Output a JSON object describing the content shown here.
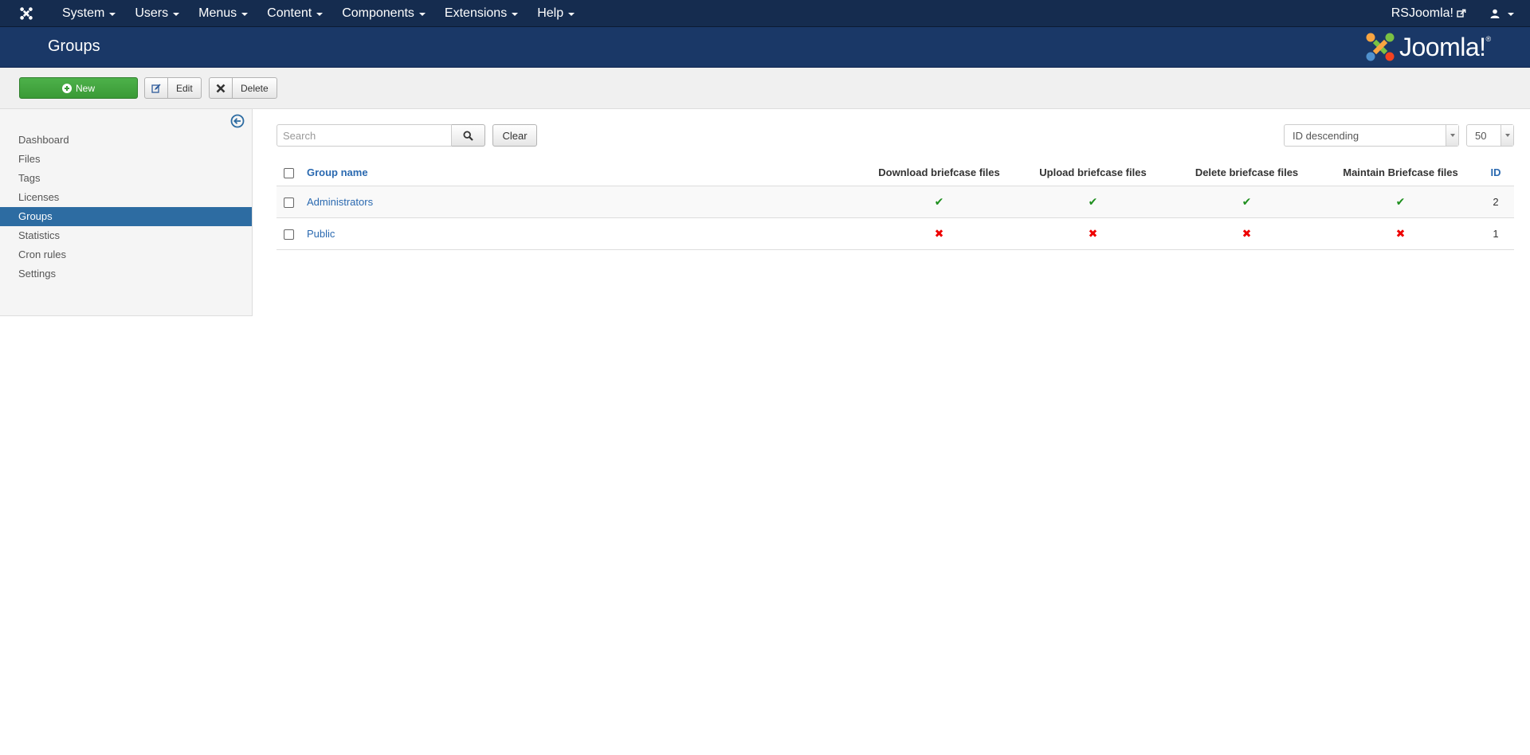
{
  "navbar": {
    "menu": [
      {
        "label": "System"
      },
      {
        "label": "Users"
      },
      {
        "label": "Menus"
      },
      {
        "label": "Content"
      },
      {
        "label": "Components"
      },
      {
        "label": "Extensions"
      },
      {
        "label": "Help"
      }
    ],
    "site_label": "RSJoomla!"
  },
  "header": {
    "title": "Groups",
    "brand": "Joomla!",
    "brand_mark": "®"
  },
  "toolbar": {
    "new_label": "New",
    "edit_label": "Edit",
    "delete_label": "Delete"
  },
  "sidebar": {
    "items": [
      {
        "label": "Dashboard"
      },
      {
        "label": "Files"
      },
      {
        "label": "Tags"
      },
      {
        "label": "Licenses"
      },
      {
        "label": "Groups",
        "active": true
      },
      {
        "label": "Statistics"
      },
      {
        "label": "Cron rules"
      },
      {
        "label": "Settings"
      }
    ]
  },
  "filters": {
    "search_placeholder": "Search",
    "search_value": "",
    "clear_label": "Clear",
    "sort_selected": "ID descending",
    "limit_selected": "50"
  },
  "table": {
    "columns": {
      "name": "Group name",
      "download": "Download briefcase files",
      "upload": "Upload briefcase files",
      "delete": "Delete briefcase files",
      "maintain": "Maintain Briefcase files",
      "id": "ID"
    },
    "rows": [
      {
        "name": "Administrators",
        "download": true,
        "upload": true,
        "delete": true,
        "maintain": true,
        "id": "2"
      },
      {
        "name": "Public",
        "download": false,
        "upload": false,
        "delete": false,
        "maintain": false,
        "id": "1"
      }
    ]
  },
  "colors": {
    "navbar_bg": "#152c4f",
    "header_bg": "#1a3867",
    "active_item": "#2d6ca2",
    "new_button": "#3a9a36",
    "link": "#2a69b0",
    "ok": "#1e8f1e",
    "no": "#e00000"
  },
  "icons": {
    "ok": "check-icon",
    "no": "cross-icon"
  }
}
